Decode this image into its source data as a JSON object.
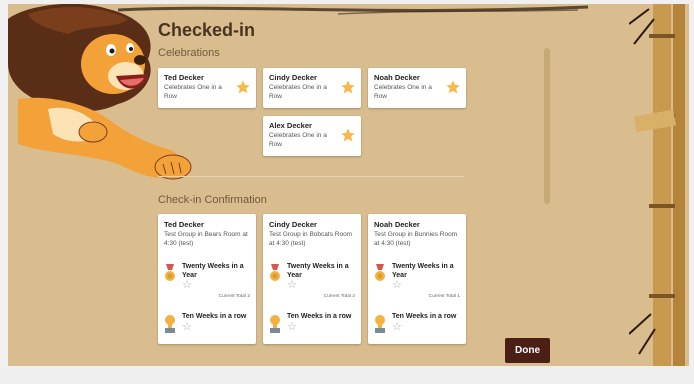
{
  "page": {
    "title": "Checked-in"
  },
  "celebrations": {
    "heading": "Celebrations",
    "cards": [
      {
        "name": "Ted Decker",
        "detail": "Celebrates One in a Row"
      },
      {
        "name": "Cindy Decker",
        "detail": "Celebrates One in a Row"
      },
      {
        "name": "Noah Decker",
        "detail": "Celebrates One in a Row"
      },
      {
        "name": "Alex Decker",
        "detail": "Celebrates One in a Row"
      }
    ]
  },
  "confirmation": {
    "heading": "Check-in Confirmation",
    "cards": [
      {
        "name": "Ted Decker",
        "detail": "Test Group in Bears Room at 4:30 (test)",
        "achievements": [
          {
            "label": "Twenty Weeks in a Year",
            "total": "Current Total 2"
          },
          {
            "label": "Ten Weeks in a row",
            "total": ""
          }
        ]
      },
      {
        "name": "Cindy Decker",
        "detail": "Test Group in Bobcats Room at 4:30 (test)",
        "achievements": [
          {
            "label": "Twenty Weeks in a Year",
            "total": "Current Total 2"
          },
          {
            "label": "Ten Weeks in a row",
            "total": ""
          }
        ]
      },
      {
        "name": "Noah Decker",
        "detail": "Test Group in Bunnies Room at 4:30 (test)",
        "achievements": [
          {
            "label": "Twenty Weeks in a Year",
            "total": "Current Total 1"
          },
          {
            "label": "Ten Weeks in a row",
            "total": ""
          }
        ]
      }
    ]
  },
  "actions": {
    "done_label": "Done"
  },
  "icons": {
    "celebration": "star-icon",
    "achievement": "medal-icon",
    "progress": "star-outline-icon"
  },
  "colors": {
    "background": "#d9bd8f",
    "done_button": "#4b1e16",
    "star": "#f6b94a"
  }
}
